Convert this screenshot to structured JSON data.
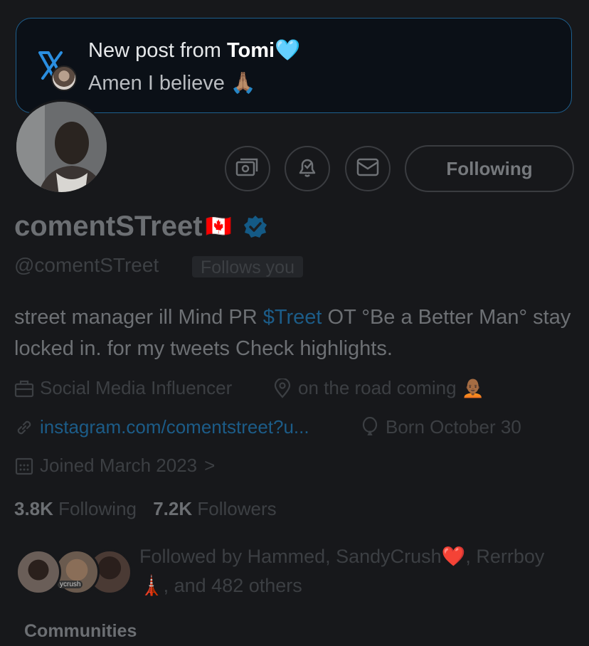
{
  "notification": {
    "prefix": "New post from ",
    "author": "Tomi",
    "author_emoji": "🩵",
    "body": "Amen I believe 🙏🏽",
    "app_icon": "x-logo-icon"
  },
  "profile": {
    "display_name": "comentSTreet",
    "flag": "🇨🇦",
    "verified_icon": "verified-badge-icon",
    "handle": "@comentSTreet",
    "follows_you": "Follows you",
    "bio_part1": "street manager ill Mind PR ",
    "bio_cashtag": "$Treet",
    "bio_part2": " OT °Be a Better Man° stay locked in. for my tweets Check highlights.",
    "category": "Social Media Influencer",
    "location": "on the road coming 🧑🏾‍🦲",
    "website": "instagram.com/comentstreet?u...",
    "birthday": "Born October 30",
    "joined": "Joined March 2023",
    "joined_chevron": ">"
  },
  "actions": {
    "following_label": "Following",
    "monetize_icon": "subscribe-money-icon",
    "notify_icon": "bell-check-icon",
    "message_icon": "envelope-icon"
  },
  "stats": {
    "following_count": "3.8K",
    "following_label": "Following",
    "followers_count": "7.2K",
    "followers_label": "Followers"
  },
  "followed_by": {
    "text_part1": "Followed by Hammed, SandyCrush",
    "heart": "❤️",
    "text_part2": ", Rerrboy ",
    "tower": "🗼",
    "text_part3": ", and 482 others",
    "face_tag": "ycrush"
  },
  "sections": {
    "communities": "Communities"
  },
  "colors": {
    "background": "#17181b",
    "accent_link": "#1c5c88",
    "notification_border": "#1e5f8e",
    "verified": "#1d9bf0"
  }
}
